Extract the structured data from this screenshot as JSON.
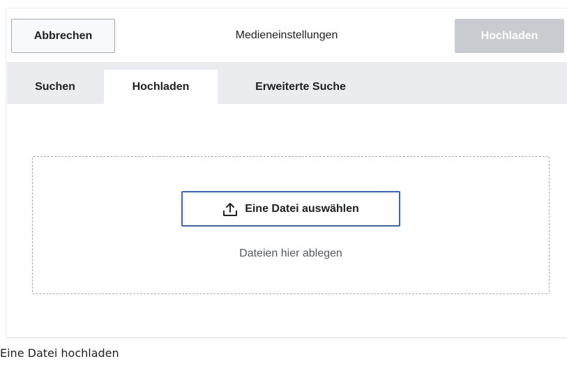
{
  "dialog": {
    "title": "Medieneinstellungen",
    "cancel_label": "Abbrechen",
    "upload_label": "Hochladen"
  },
  "tabs": [
    {
      "label": "Suchen",
      "active": false
    },
    {
      "label": "Hochladen",
      "active": true
    },
    {
      "label": "Erweiterte Suche",
      "active": false
    }
  ],
  "dropzone": {
    "select_label": "Eine Datei auswählen",
    "select_icon": "upload-icon",
    "hint": "Dateien hier ablegen"
  },
  "caption": "Eine Datei hochladen",
  "colors": {
    "accent": "#3366cc",
    "disabled_button": "#c8ccd1",
    "tab_bar": "#eaecf0"
  }
}
